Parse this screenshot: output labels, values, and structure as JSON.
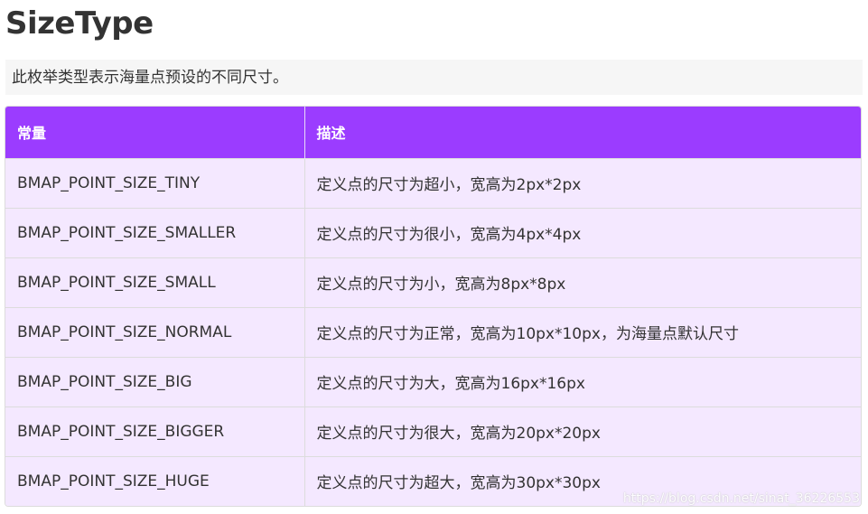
{
  "page": {
    "title": "SizeType",
    "description": "此枚举类型表示海量点预设的不同尺寸。"
  },
  "table": {
    "headers": [
      "常量",
      "描述"
    ],
    "rows": [
      [
        "BMAP_POINT_SIZE_TINY",
        "定义点的尺寸为超小，宽高为2px*2px"
      ],
      [
        "BMAP_POINT_SIZE_SMALLER",
        "定义点的尺寸为很小，宽高为4px*4px"
      ],
      [
        "BMAP_POINT_SIZE_SMALL",
        "定义点的尺寸为小，宽高为8px*8px"
      ],
      [
        "BMAP_POINT_SIZE_NORMAL",
        "定义点的尺寸为正常，宽高为10px*10px，为海量点默认尺寸"
      ],
      [
        "BMAP_POINT_SIZE_BIG",
        "定义点的尺寸为大，宽高为16px*16px"
      ],
      [
        "BMAP_POINT_SIZE_BIGGER",
        "定义点的尺寸为很大，宽高为20px*20px"
      ],
      [
        "BMAP_POINT_SIZE_HUGE",
        "定义点的尺寸为超大，宽高为30px*30px"
      ]
    ]
  },
  "watermark": "https://blog.csdn.net/sinat_36226553",
  "colors": {
    "header_bg": "#9b3cff",
    "row_bg": "#f4e8ff",
    "description_bg": "#f6f6f6"
  }
}
